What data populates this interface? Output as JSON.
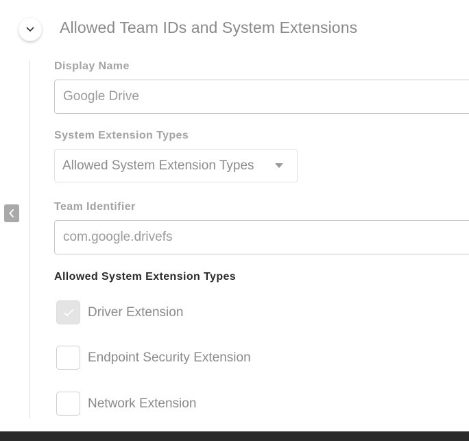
{
  "section": {
    "title": "Allowed Team IDs and System Extensions",
    "toggle_icon": "chevron-down-icon",
    "side_tab_icon": "chevron-left-icon"
  },
  "display_name": {
    "label": "Display Name",
    "value": "Google Drive"
  },
  "system_extension_types": {
    "label": "System Extension Types",
    "selected": "Allowed System Extension Types"
  },
  "team_identifier": {
    "label": "Team Identifier",
    "value": "com.google.drivefs"
  },
  "allowed_types": {
    "heading": "Allowed System Extension Types",
    "options": [
      {
        "label": "Driver Extension",
        "checked": true
      },
      {
        "label": "Endpoint Security Extension",
        "checked": false
      },
      {
        "label": "Network Extension",
        "checked": false
      }
    ]
  },
  "colors": {
    "muted_text": "#8a8a8a",
    "heading_text": "#2b2b2b",
    "border": "#c9c9c9",
    "checked_fill": "#e4e4e4",
    "footer_bar": "#2b2b2b"
  }
}
